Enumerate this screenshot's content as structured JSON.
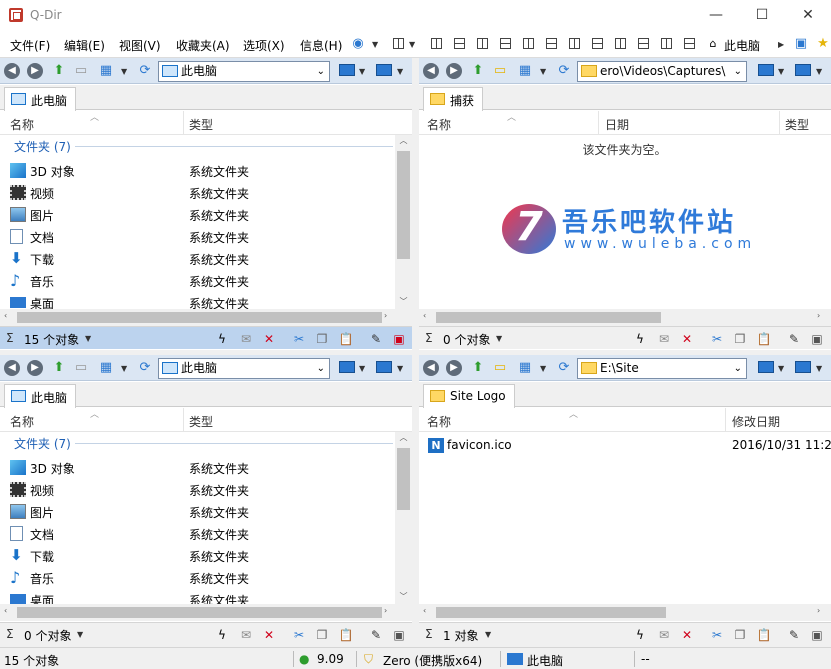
{
  "window": {
    "title": "Q-Dir",
    "minimize": "—",
    "maximize": "☐",
    "close": "✕"
  },
  "menu": {
    "items": [
      "文件(F)",
      "编辑(E)",
      "视图(V)",
      "收藏夹(A)",
      "选项(X)",
      "信息(H)"
    ],
    "this_pc": "此电脑"
  },
  "panes": {
    "top_left": {
      "address": "此电脑",
      "tab": "此电脑",
      "columns": [
        "名称",
        "类型"
      ],
      "group": "文件夹 (7)",
      "rows": [
        {
          "name": "3D 对象",
          "type": "系统文件夹",
          "icon": "3d-objects-icon"
        },
        {
          "name": "视频",
          "type": "系统文件夹",
          "icon": "video-icon"
        },
        {
          "name": "图片",
          "type": "系统文件夹",
          "icon": "pictures-icon"
        },
        {
          "name": "文档",
          "type": "系统文件夹",
          "icon": "documents-icon"
        },
        {
          "name": "下载",
          "type": "系统文件夹",
          "icon": "downloads-icon"
        },
        {
          "name": "音乐",
          "type": "系统文件夹",
          "icon": "music-icon"
        },
        {
          "name": "桌面",
          "type": "系统文件夹",
          "icon": "desktop-icon"
        }
      ],
      "status": "15 个对象"
    },
    "top_right": {
      "address": "ero\\Videos\\Captures\\",
      "tab": "捕获",
      "columns": [
        "名称",
        "日期",
        "类型"
      ],
      "empty_text": "该文件夹为空。",
      "status": "0 个对象"
    },
    "bottom_left": {
      "address": "此电脑",
      "tab": "此电脑",
      "columns": [
        "名称",
        "类型"
      ],
      "group": "文件夹 (7)",
      "rows": [
        {
          "name": "3D 对象",
          "type": "系统文件夹",
          "icon": "3d-objects-icon"
        },
        {
          "name": "视频",
          "type": "系统文件夹",
          "icon": "video-icon"
        },
        {
          "name": "图片",
          "type": "系统文件夹",
          "icon": "pictures-icon"
        },
        {
          "name": "文档",
          "type": "系统文件夹",
          "icon": "documents-icon"
        },
        {
          "name": "下载",
          "type": "系统文件夹",
          "icon": "downloads-icon"
        },
        {
          "name": "音乐",
          "type": "系统文件夹",
          "icon": "music-icon"
        },
        {
          "name": "桌面",
          "type": "系统文件夹",
          "icon": "desktop-icon"
        }
      ],
      "status": "0 个对象"
    },
    "bottom_right": {
      "address": "E:\\Site",
      "tab": "Site Logo",
      "columns": [
        "名称",
        "修改日期"
      ],
      "file": {
        "name": "favicon.ico",
        "date": "2016/10/31 11:2"
      },
      "status": "1 对象"
    }
  },
  "statusbar": {
    "count": "15 个对象",
    "version": "9.09",
    "user": "Zero (便携版x64)",
    "location": "此电脑",
    "extra": "--"
  },
  "watermark": {
    "cn": "吾乐吧软件站",
    "url": "www.wuleba.com"
  },
  "colors": {
    "accent": "#2b78d0",
    "toolbar": "#dbe6f3",
    "active_status": "#bcd3ee",
    "group": "#1e5fb4",
    "delete": "#d0021b"
  }
}
